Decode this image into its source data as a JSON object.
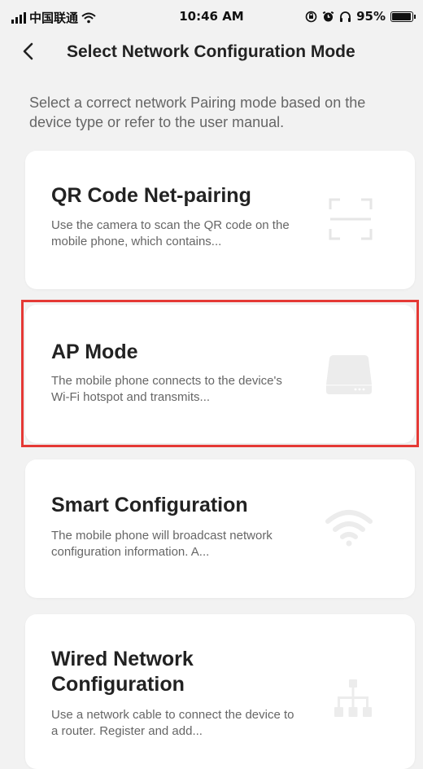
{
  "status_bar": {
    "carrier": "中国联通",
    "time": "10:46 AM",
    "battery": "95%",
    "battery_level": 0.95
  },
  "nav": {
    "title": "Select Network Configuration Mode"
  },
  "subtitle": "Select a correct network Pairing mode based on the device type or refer to the user manual.",
  "modes": [
    {
      "title": "QR Code Net-pairing",
      "description": "Use the camera to scan the QR code on the mobile phone, which contains...",
      "icon": "qr-scan-icon"
    },
    {
      "title": "AP Mode",
      "description": "The mobile phone connects to the device's Wi-Fi hotspot and transmits...",
      "icon": "router-icon"
    },
    {
      "title": "Smart Configuration",
      "description": "The mobile phone will broadcast network configuration information. A...",
      "icon": "wifi-icon"
    },
    {
      "title": "Wired Network Configuration",
      "description": "Use a network cable to connect the device to a router. Register and add...",
      "icon": "network-tree-icon"
    }
  ],
  "colors": {
    "background": "#f2f2f2",
    "card": "#ffffff",
    "highlight": "#e53935",
    "icon": "#e8e8e8"
  }
}
